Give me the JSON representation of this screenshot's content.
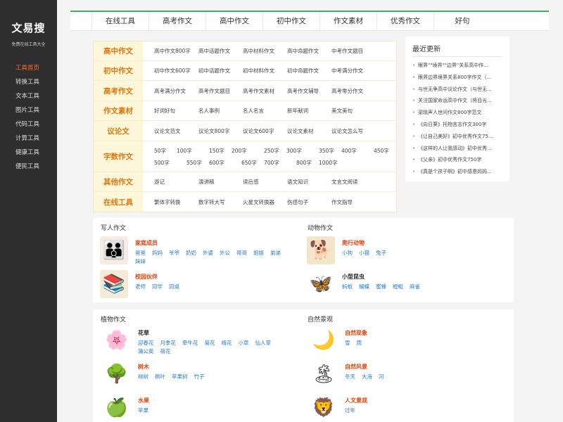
{
  "sidebar": {
    "logo": "文易搜",
    "tagline": "免费在线工具大全",
    "items": [
      {
        "label": "工具首页",
        "active": true
      },
      {
        "label": "转换工具"
      },
      {
        "label": "文本工具"
      },
      {
        "label": "图片工具"
      },
      {
        "label": "代码工具"
      },
      {
        "label": "计算工具"
      },
      {
        "label": "健康工具"
      },
      {
        "label": "便民工具"
      }
    ]
  },
  "topnav": [
    "在线工具",
    "高考作文",
    "高中作文",
    "初中作文",
    "作文素材",
    "优秀作文",
    "好句"
  ],
  "categories": [
    {
      "label": "高中作文",
      "links": [
        "高中作文800字",
        "高中话题作文",
        "高中材料作文",
        "高中命题作文",
        "中考作文题目"
      ]
    },
    {
      "label": "初中作文",
      "links": [
        "初中作文600字",
        "初中话题作文",
        "初中材料作文",
        "初中命题作文",
        "中考满分作文"
      ]
    },
    {
      "label": "高考作文",
      "links": [
        "高考满分作文",
        "高考作文题目",
        "高考作文素材",
        "高考作文辅导",
        "高考零分作文"
      ]
    },
    {
      "label": "作文素材",
      "links": [
        "好词好句",
        "名人事例",
        "名人名言",
        "新年献词",
        "美文美句"
      ]
    },
    {
      "label": "议论文",
      "links": [
        "议论文范文",
        "议论文800字",
        "议论文600字",
        "议论文素材",
        "议论文怎么写"
      ]
    },
    {
      "label": "字数作文",
      "links": [
        "50字",
        "100字",
        "150字",
        "200字",
        "250字",
        "300字",
        "350字",
        "400字",
        "450字",
        "500字",
        "550字",
        "600字",
        "650字",
        "700字",
        "800字",
        "1000字"
      ]
    },
    {
      "label": "其他作文",
      "links": [
        "游记",
        "演讲稿",
        "读后感",
        "语文知识",
        "文言文阅读"
      ]
    },
    {
      "label": "在线工具",
      "links": [
        "繁体字转换",
        "数字转大写",
        "火星文转换器",
        "伤感句子",
        "作文指导"
      ]
    }
  ],
  "recent": {
    "title": "最近更新",
    "items": [
      "眼界\"\"境界\"\"边界\"关系高中作...",
      "眼界边界境界关系800字作文（...",
      "与世无争高中议论作文（与世无...",
      "关注国家命运高中作文（将目光...",
      "梁晓声人世间作文800字范文",
      "《向日葵》托物言志作文300字",
      "《让自己美好》初中优秀作文75...",
      "《这样的人让我感动》初中优秀...",
      "《父亲》初中优秀作文750字",
      "《真是个孩子啊》初中感恩妈妈..."
    ]
  },
  "panels": {
    "people": {
      "title": "写人作文",
      "groups": [
        {
          "name": "家庭成员",
          "icon": "family-photo",
          "items": [
            "爸爸",
            "妈妈",
            "爷爷",
            "奶奶",
            "外婆",
            "外公",
            "哥哥",
            "姐姐",
            "弟弟",
            "妹妹"
          ]
        },
        {
          "name": "校园伙伴",
          "icon": "students-photo",
          "items": [
            "老师",
            "同学",
            "同桌"
          ]
        }
      ]
    },
    "animals": {
      "title": "动物作文",
      "groups": [
        {
          "name": "爬行动物",
          "icon": "dog-photo",
          "items": [
            "小狗",
            "小猫",
            "兔子"
          ]
        },
        {
          "name": "小型昆虫",
          "icon": "butterfly-photo",
          "items": [
            "蚂蚁",
            "蝴蝶",
            "蜜蜂",
            "蝗蜓",
            "麻雀"
          ]
        }
      ]
    },
    "plants": {
      "title": "植物作文",
      "groups": [
        {
          "name": "花草",
          "icon": "flower-icon",
          "items": [
            "迎春花",
            "月季花",
            "牵牛花",
            "菊花",
            "梅花",
            "小草",
            "仙人掌",
            "蒲公英",
            "荷花"
          ]
        },
        {
          "name": "树木",
          "icon": "tree-icon",
          "items": [
            "柳树",
            "枫叶",
            "苹果树",
            "竹子"
          ]
        },
        {
          "name": "水果",
          "icon": "fruit-icon",
          "items": [
            "苹果"
          ]
        }
      ]
    },
    "nature": {
      "title": "自然景观",
      "groups": [
        {
          "name": "自然现象",
          "icon": "moon-icon",
          "items": [
            "雪",
            "雨"
          ]
        },
        {
          "name": "自然风景",
          "icon": "island-icon",
          "items": [
            "冬天",
            "大海",
            "河"
          ]
        },
        {
          "name": "人文景观",
          "icon": "lion-icon",
          "items": [
            "过年"
          ]
        }
      ]
    }
  },
  "colors": {
    "accent": "#ff6a2c",
    "category_label": "#e2760c",
    "category_bg": "#fdf7da",
    "link_blue": "#2a7ec8",
    "group_red": "#e2430c",
    "sidebar_bg": "#2e2e2e",
    "topnav_border": "#35b36a"
  }
}
